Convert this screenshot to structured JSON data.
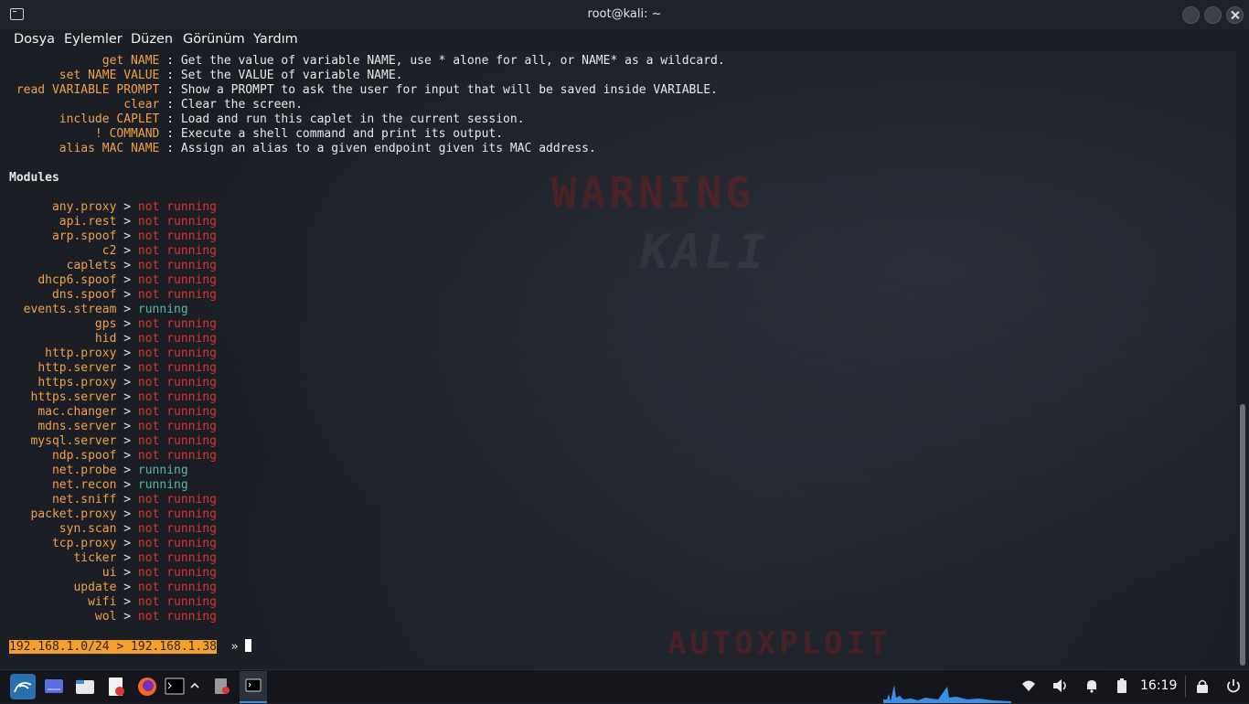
{
  "window": {
    "title": "root@kali: ~"
  },
  "menu": [
    "Dosya",
    "Eylemler",
    "Düzen",
    "Görünüm",
    "Yardım"
  ],
  "help": [
    {
      "cmd": "get NAME",
      "desc": "Get the value of variable NAME, use * alone for all, or NAME* as a wildcard."
    },
    {
      "cmd": "set NAME VALUE",
      "desc": "Set the VALUE of variable NAME."
    },
    {
      "cmd": "read VARIABLE PROMPT",
      "desc": "Show a PROMPT to ask the user for input that will be saved inside VARIABLE."
    },
    {
      "cmd": "clear",
      "desc": "Clear the screen."
    },
    {
      "cmd": "include CAPLET",
      "desc": "Load and run this caplet in the current session."
    },
    {
      "cmd": "! COMMAND",
      "desc": "Execute a shell command and print its output."
    },
    {
      "cmd": "alias MAC NAME",
      "desc": "Assign an alias to a given endpoint given its MAC address."
    }
  ],
  "modules_heading": "Modules",
  "modules": [
    {
      "name": "any.proxy",
      "status": "not running"
    },
    {
      "name": "api.rest",
      "status": "not running"
    },
    {
      "name": "arp.spoof",
      "status": "not running"
    },
    {
      "name": "c2",
      "status": "not running"
    },
    {
      "name": "caplets",
      "status": "not running"
    },
    {
      "name": "dhcp6.spoof",
      "status": "not running"
    },
    {
      "name": "dns.spoof",
      "status": "not running"
    },
    {
      "name": "events.stream",
      "status": "running"
    },
    {
      "name": "gps",
      "status": "not running"
    },
    {
      "name": "hid",
      "status": "not running"
    },
    {
      "name": "http.proxy",
      "status": "not running"
    },
    {
      "name": "http.server",
      "status": "not running"
    },
    {
      "name": "https.proxy",
      "status": "not running"
    },
    {
      "name": "https.server",
      "status": "not running"
    },
    {
      "name": "mac.changer",
      "status": "not running"
    },
    {
      "name": "mdns.server",
      "status": "not running"
    },
    {
      "name": "mysql.server",
      "status": "not running"
    },
    {
      "name": "ndp.spoof",
      "status": "not running"
    },
    {
      "name": "net.probe",
      "status": "running"
    },
    {
      "name": "net.recon",
      "status": "running"
    },
    {
      "name": "net.sniff",
      "status": "not running"
    },
    {
      "name": "packet.proxy",
      "status": "not running"
    },
    {
      "name": "syn.scan",
      "status": "not running"
    },
    {
      "name": "tcp.proxy",
      "status": "not running"
    },
    {
      "name": "ticker",
      "status": "not running"
    },
    {
      "name": "ui",
      "status": "not running"
    },
    {
      "name": "update",
      "status": "not running"
    },
    {
      "name": "wifi",
      "status": "not running"
    },
    {
      "name": "wol",
      "status": "not running"
    }
  ],
  "prompt": {
    "host": "192.168.1.0/24 > 192.168.1.38",
    "symbol": "»"
  },
  "wallpaper_text": {
    "warning": "WARNING",
    "kali": "KALI",
    "autoxploit": "AUTOXPLOIT"
  },
  "taskbar": {
    "clock": "16:19",
    "icons": [
      "kali-menu-icon",
      "workspace-icon",
      "file-manager-icon",
      "text-editor-icon",
      "firefox-icon",
      "terminal-icon",
      "chevron-up-icon",
      "app-icon",
      "active-terminal-icon"
    ],
    "tray": [
      "wifi-icon",
      "volume-icon",
      "notification-bell-icon",
      "battery-icon",
      "lock-icon",
      "power-icon"
    ]
  },
  "colors": {
    "command": "#f0a04a",
    "not_running": "#e0332d",
    "running": "#56b6a0",
    "prompt_bg": "#f5a02e"
  }
}
